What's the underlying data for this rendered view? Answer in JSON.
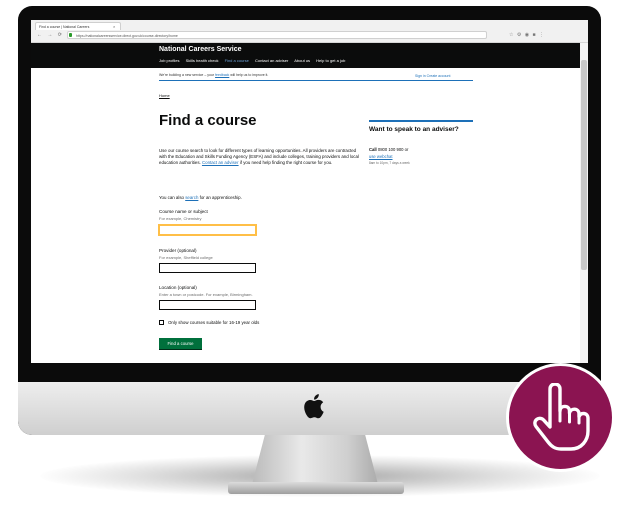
{
  "browser": {
    "tab_title": "Find a course | National Careers",
    "tab_close": "×",
    "nav_icons": "← → ⟳ ⌂",
    "url": "https://nationalcareersservice.direct.gov.uk/course-directory/home",
    "extension_icons": "☆ ⚙ ◉ ■ ⋮"
  },
  "site": {
    "name": "National Careers Service",
    "nav": [
      "Job profiles",
      "Skills health check",
      "Find a course",
      "Contact an adviser",
      "About us",
      "Help to get a job"
    ],
    "current_nav_index": 2
  },
  "beta": {
    "text_before": "We're building a new service – your ",
    "feedback_link": "feedback",
    "text_after": " will help us to improve it.",
    "right_links": "Sign in   Create account"
  },
  "breadcrumb": "Home",
  "page": {
    "title": "Find a course",
    "intro_before": "Use our course search to look for different types of learning opportunities. All providers are contracted with the Education and Skills Funding Agency (ESFA) and include colleges, training providers and local education authorities. ",
    "intro_link": "Contact an adviser",
    "intro_after": " if you need help finding the right course for you.",
    "apprentice_before": "You can also ",
    "apprentice_link": "search",
    "apprentice_after": " for an apprenticeship."
  },
  "form": {
    "course_label": "Course name or subject",
    "course_hint": "For example, Chemistry",
    "provider_label": "Provider (optional)",
    "provider_hint": "For example, Sheffield college",
    "location_label": "Location (optional)",
    "location_hint": "Enter a town or postcode. For example, Birmingham.",
    "checkbox_label": "Only show courses suitable for 16-19 year olds",
    "submit_label": "Find a course"
  },
  "sidebar": {
    "title": "Want to speak to an adviser?",
    "call_label": "Call",
    "phone": "0800 100 900",
    "or": "or",
    "webchat": "use webchat",
    "hours": "8am to 10pm, 7 days a week"
  },
  "colors": {
    "badge": "#8b1451",
    "header": "#0b0c0c",
    "button": "#00703c",
    "link": "#1d70b8",
    "focus": "#ffbf47"
  },
  "icons": {
    "apple": "apple-logo-icon",
    "hand": "pointing-hand-icon"
  }
}
